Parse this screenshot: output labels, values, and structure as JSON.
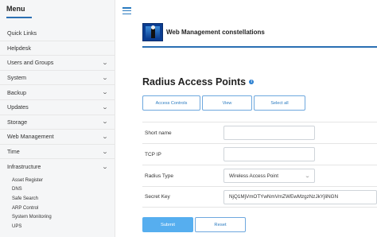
{
  "sidebar": {
    "title": "Menu",
    "items": [
      {
        "label": "Quick Links",
        "has_chevron": false
      },
      {
        "label": "Helpdesk",
        "has_chevron": false
      },
      {
        "label": "Users and Groups",
        "has_chevron": true
      },
      {
        "label": "System",
        "has_chevron": true
      },
      {
        "label": "Backup",
        "has_chevron": true
      },
      {
        "label": "Updates",
        "has_chevron": true
      },
      {
        "label": "Storage",
        "has_chevron": true
      },
      {
        "label": "Web Management",
        "has_chevron": true
      },
      {
        "label": "Time",
        "has_chevron": true
      },
      {
        "label": "Infrastructure",
        "has_chevron": true
      }
    ],
    "subitems": [
      "Asset Register",
      "DNS",
      "Safe Search",
      "ARP Control",
      "System Monitoring",
      "UPS"
    ]
  },
  "banner": {
    "title": "Web Management constellations"
  },
  "page": {
    "title": "Radius Access Points"
  },
  "tabs": [
    {
      "label": "Access Controls"
    },
    {
      "label": "View"
    },
    {
      "label": "Select all"
    }
  ],
  "form": {
    "short_name": {
      "label": "Short name",
      "value": ""
    },
    "tcp_ip": {
      "label": "TCP IP",
      "value": ""
    },
    "radius_type": {
      "label": "Radius Type",
      "value": "Wireless Access Point"
    },
    "secret_key": {
      "label": "Secret Key",
      "value": "NjQ1MjVmOTYwNmVmZWEwMzgzNzJkYjliNGN"
    }
  },
  "buttons": {
    "submit": "Submit",
    "reset": "Reset"
  },
  "colors": {
    "accent": "#2a6fb3",
    "link_blue": "#2b7bc0",
    "submit_bg": "#56aeef"
  }
}
